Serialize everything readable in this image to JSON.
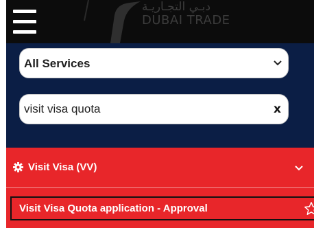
{
  "header": {
    "logo_arabic": "دبـي التجـاريـة",
    "logo_text": "DUBAI TRADE"
  },
  "search": {
    "category_select": "All Services",
    "query": "visit visa quota",
    "clear_label": "x"
  },
  "results": {
    "category_label": "Visit Visa (VV)",
    "items": [
      {
        "label": "Visit Visa Quota application - Approval"
      }
    ]
  },
  "colors": {
    "header_bg": "#0c0c0c",
    "search_panel_bg": "#0b1e45",
    "results_bg": "#e8262a"
  }
}
